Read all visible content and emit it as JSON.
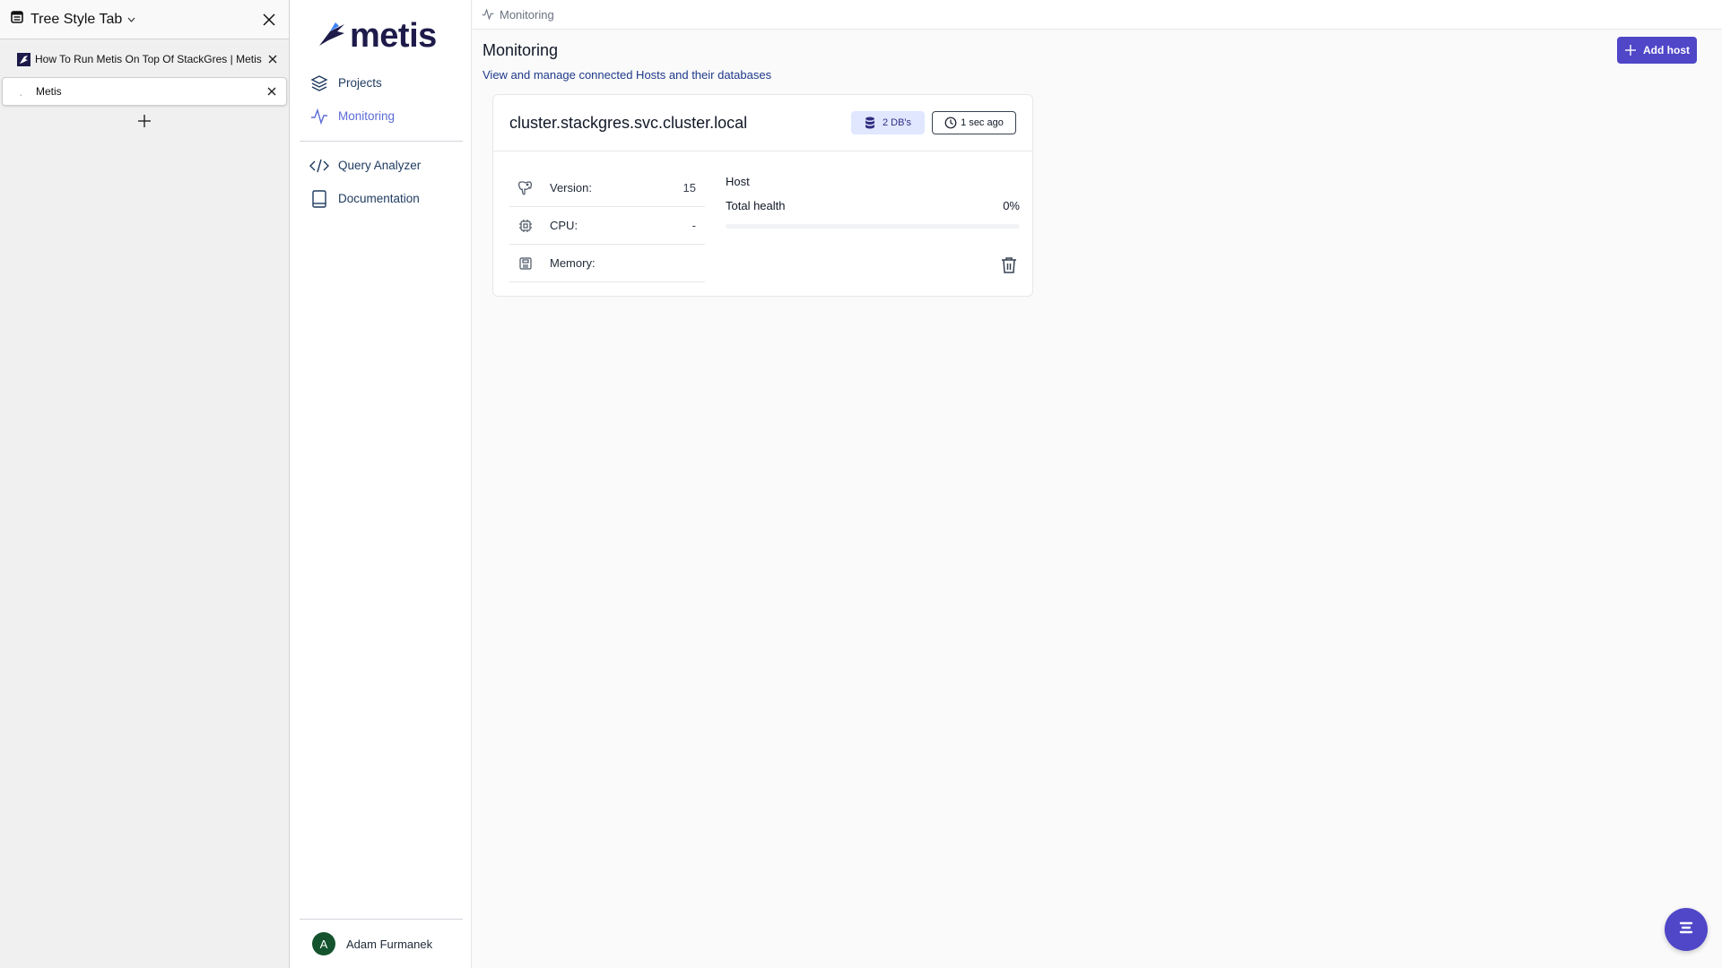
{
  "tree_style_tab": {
    "title": "Tree Style Tab",
    "tabs": [
      {
        "label": "How To Run Metis On Top Of StackGres | Metis",
        "favicon": "metis-favicon"
      },
      {
        "label": "Metis",
        "favicon": "loading-icon",
        "active": true
      }
    ],
    "icons": {
      "panel": "sidebar-panel-icon",
      "close": "close-icon",
      "new_tab": "plus-icon"
    }
  },
  "app": {
    "logo_text": "metis",
    "brand_color": "#4f46c8",
    "nav_primary": [
      {
        "label": "Projects",
        "icon": "layers-icon"
      },
      {
        "label": "Monitoring",
        "icon": "activity-icon",
        "active": true
      }
    ],
    "nav_secondary": [
      {
        "label": "Query Analyzer",
        "icon": "code-icon"
      },
      {
        "label": "Documentation",
        "icon": "book-icon"
      }
    ],
    "user": {
      "initial": "A",
      "name": "Adam Furmanek"
    }
  },
  "main": {
    "breadcrumb": "Monitoring",
    "title": "Monitoring",
    "subtitle": "View and manage connected Hosts and their databases",
    "add_host_label": "Add host",
    "host_card": {
      "host": "cluster.stackgres.svc.cluster.local",
      "db_badge": "2 DB's",
      "last_update": "1 sec ago",
      "metrics": [
        {
          "label": "Version:",
          "value": "15",
          "icon": "postgres-elephant-icon"
        },
        {
          "label": "CPU:",
          "value": "-",
          "icon": "cpu-chip-icon"
        },
        {
          "label": "Memory:",
          "value": "",
          "icon": "memory-icon"
        }
      ],
      "health_title": "Host",
      "health_label": "Total health",
      "health_value": "0%",
      "health_fraction": 0,
      "delete_icon": "trash-icon"
    }
  }
}
